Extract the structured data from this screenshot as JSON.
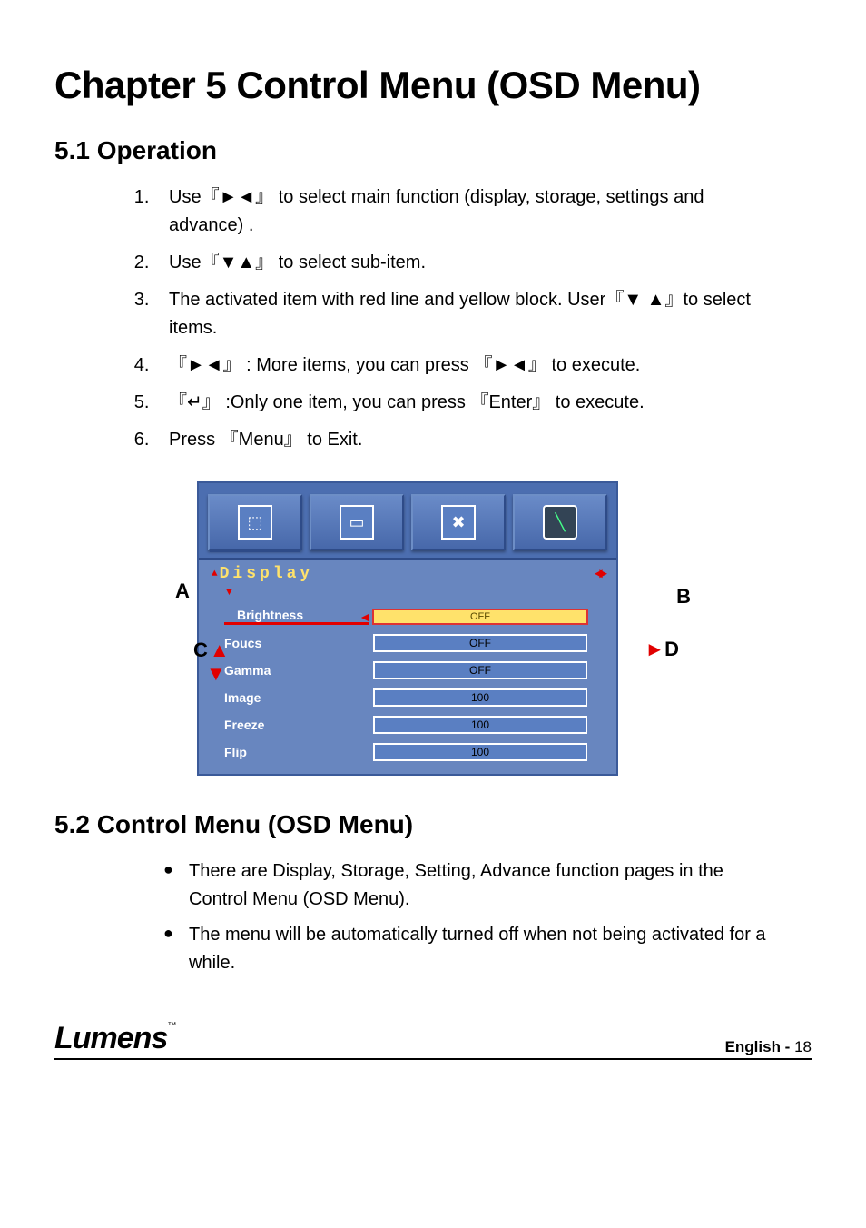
{
  "chapter_title": "Chapter 5 Control Menu (OSD Menu)",
  "section1": {
    "title": "5.1  Operation",
    "items": [
      "Use『►◄』 to select main function (display, storage, settings and advance) .",
      "Use『▼▲』 to select sub-item.",
      "The activated item with red line and yellow block. User『▼ ▲』to select items.",
      "『►◄』 : More items, you can press 『►◄』 to execute.",
      "『↵』 :Only one item, you can press 『Enter』 to execute.",
      "Press 『Menu』 to Exit."
    ]
  },
  "osd": {
    "labelA": "A",
    "labelB": "B",
    "labelC": "C",
    "labelD": "D",
    "header": "Display",
    "header_arrows": "◄►",
    "items": [
      {
        "label": "Brightness",
        "value": "OFF",
        "selected": true
      },
      {
        "label": "Foucs",
        "value": "OFF",
        "selected": false
      },
      {
        "label": "Gamma",
        "value": "OFF",
        "selected": false
      },
      {
        "label": "Image",
        "value": "100",
        "selected": false
      },
      {
        "label": "Freeze",
        "value": "100",
        "selected": false
      },
      {
        "label": "Flip",
        "value": "100",
        "selected": false
      }
    ]
  },
  "section2": {
    "title": "5.2  Control Menu (OSD Menu)",
    "bullets": [
      "There are Display, Storage, Setting, Advance function pages in the Control Menu (OSD Menu).",
      "The menu will be automatically turned off when not being activated for a while."
    ]
  },
  "footer": {
    "brand": "Lumens",
    "tm": "™",
    "lang": "English -",
    "page": "18"
  }
}
